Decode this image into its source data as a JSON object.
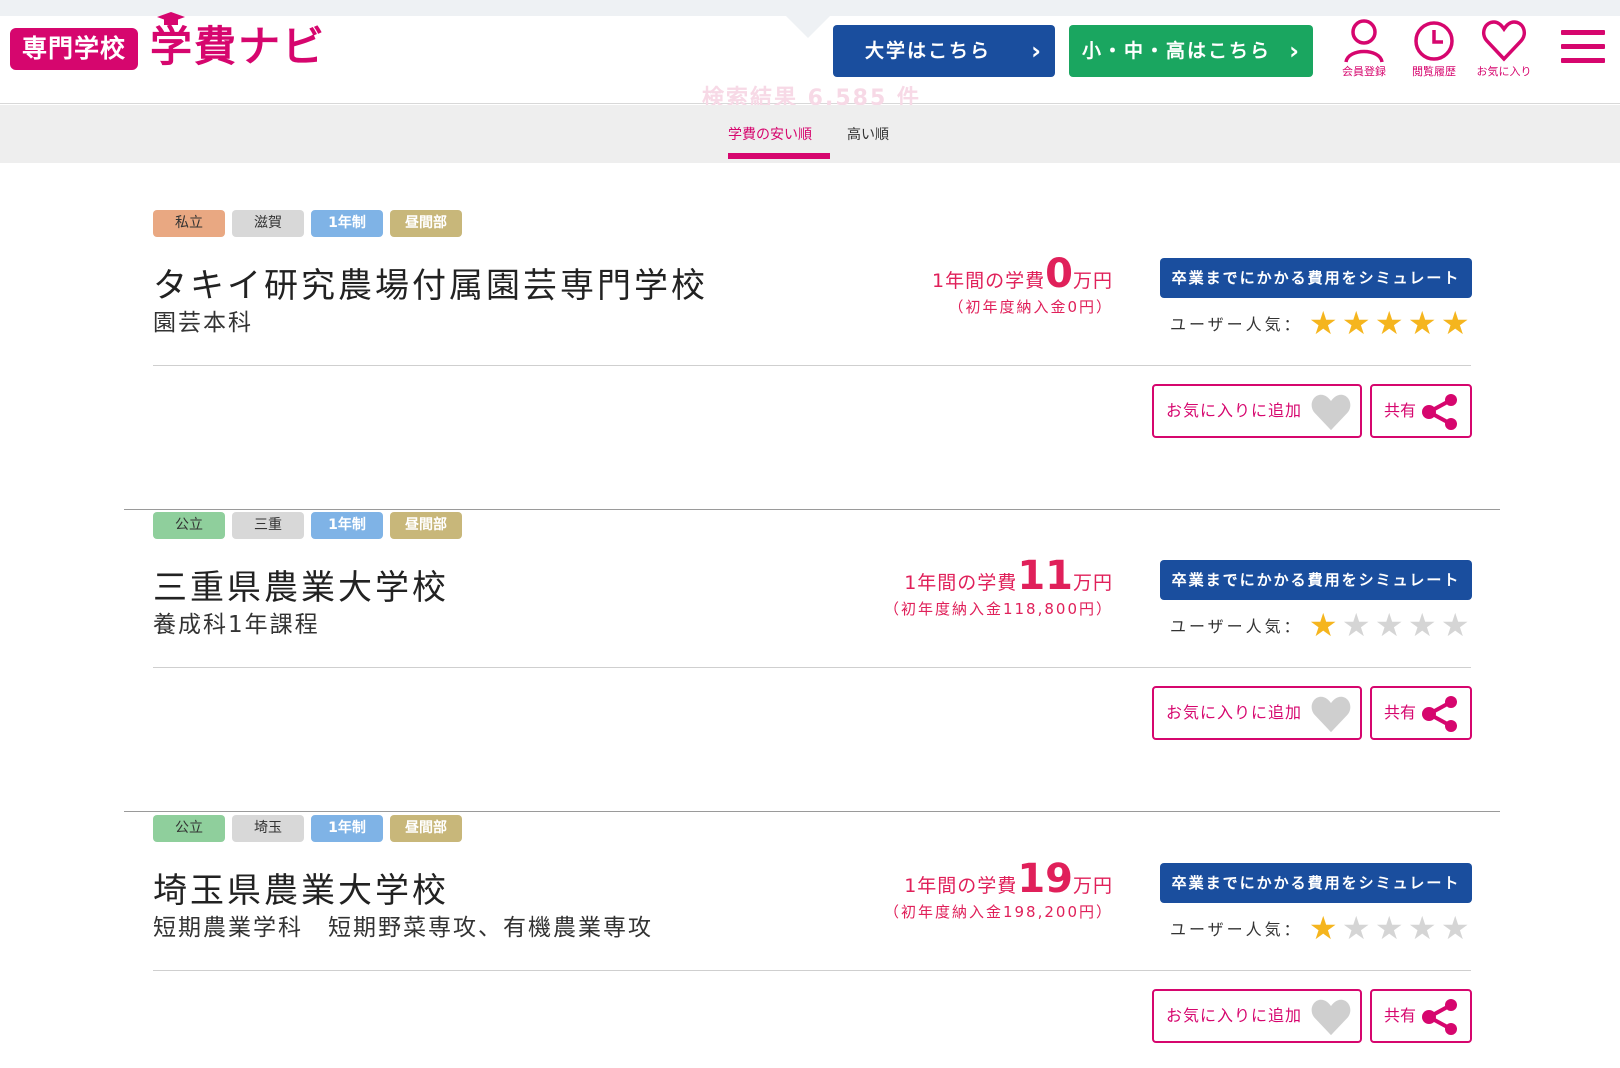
{
  "header": {
    "logo_badge": "専門学校",
    "logo_text": "学費ナビ",
    "btn_university": "大学はこちら",
    "btn_school": "小・中・高はこちら",
    "icons": [
      {
        "name": "user-icon",
        "label": "会員登録"
      },
      {
        "name": "clock-icon",
        "label": "閲覧履歴"
      },
      {
        "name": "heart-icon",
        "label": "お気に入り"
      }
    ],
    "results_ghost": "検索結果 6,585 件",
    "brand_color": "#d6066e"
  },
  "sort": {
    "cheap": "学費の安い順",
    "high": "高い順",
    "active": "cheap"
  },
  "ui": {
    "simulate": "卒業までにかかる費用をシミュレート",
    "popularity_label": "ユーザー人気：",
    "favorite": "お気に入りに追加",
    "share": "共有",
    "fee_prefix": "1年間の学費",
    "fee_unit": "万円"
  },
  "schools": [
    {
      "tags": [
        {
          "text": "私立",
          "color": "#e9a882",
          "bold": false
        },
        {
          "text": "滋賀",
          "color": "#d8d8d8",
          "bold": false
        },
        {
          "text": "1年制",
          "color": "#7fb3e6",
          "bold": true
        },
        {
          "text": "昼間部",
          "color": "#c8b77a",
          "bold": true
        }
      ],
      "name": "タキイ研究農場付属園芸専門学校",
      "course": "園芸本科",
      "fee": "0",
      "entry": "（初年度納入金0円）",
      "stars": 5
    },
    {
      "tags": [
        {
          "text": "公立",
          "color": "#8fcf9c",
          "bold": false
        },
        {
          "text": "三重",
          "color": "#d8d8d8",
          "bold": false
        },
        {
          "text": "1年制",
          "color": "#7fb3e6",
          "bold": true
        },
        {
          "text": "昼間部",
          "color": "#c8b77a",
          "bold": true
        }
      ],
      "name": "三重県農業大学校",
      "course": "養成科1年課程",
      "fee": "11",
      "entry": "（初年度納入金118,800円）",
      "stars": 1
    },
    {
      "tags": [
        {
          "text": "公立",
          "color": "#8fcf9c",
          "bold": false
        },
        {
          "text": "埼玉",
          "color": "#d8d8d8",
          "bold": false
        },
        {
          "text": "1年制",
          "color": "#7fb3e6",
          "bold": true
        },
        {
          "text": "昼間部",
          "color": "#c8b77a",
          "bold": true
        }
      ],
      "name": "埼玉県農業大学校",
      "course": "短期農業学科　短期野菜専攻、有機農業専攻",
      "fee": "19",
      "entry": "（初年度納入金198,200円）",
      "stars": 1
    }
  ]
}
